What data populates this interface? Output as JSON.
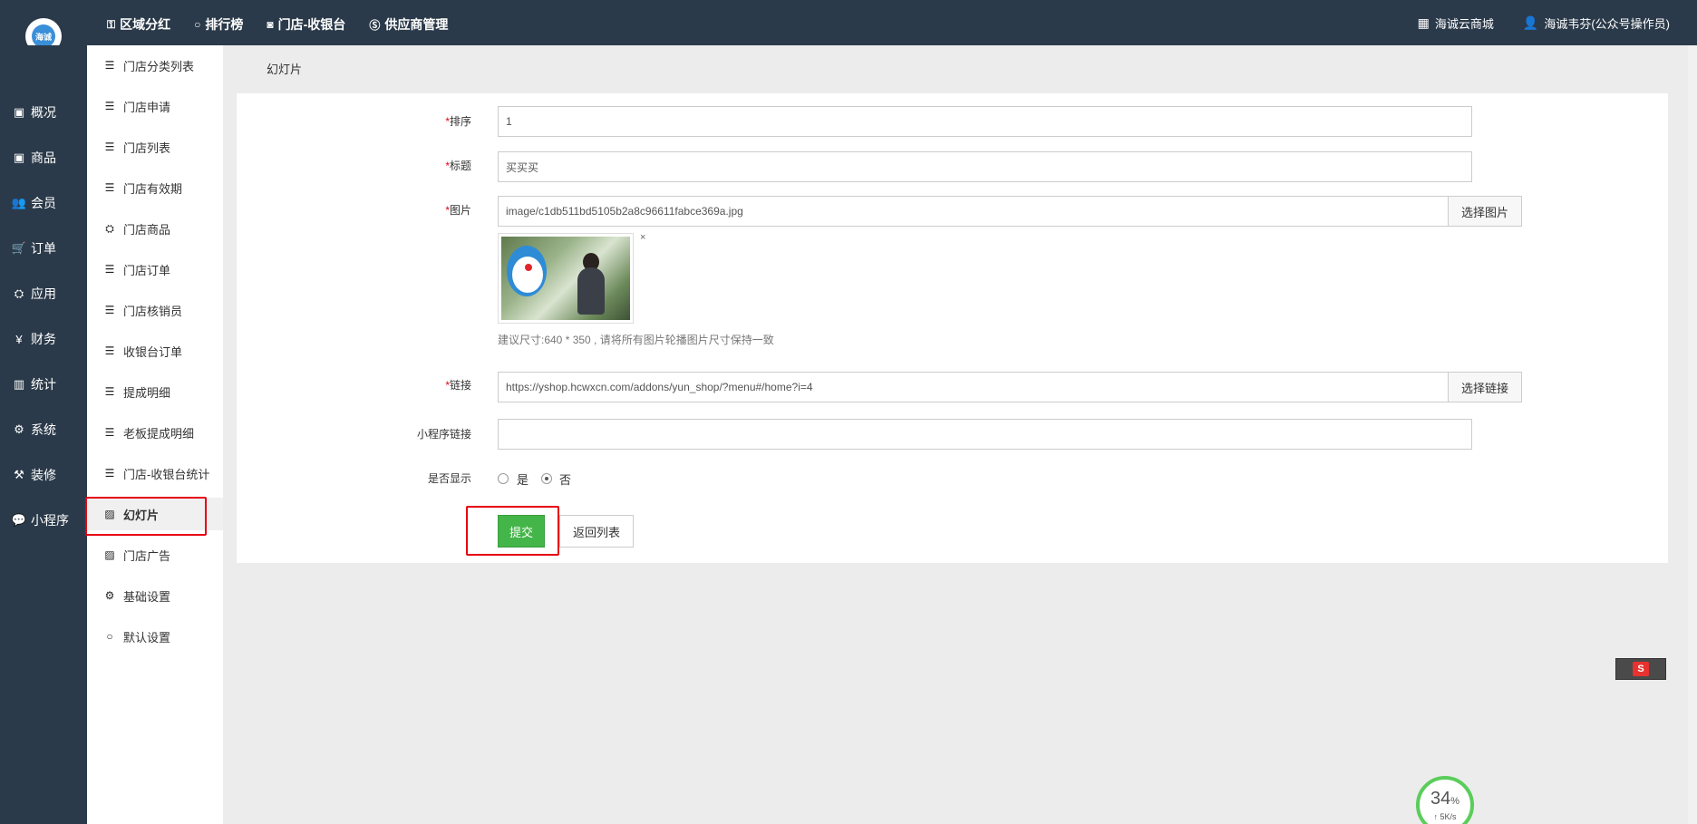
{
  "topbar": {
    "logo_text": "海诚",
    "nav": [
      {
        "icon": "key-icon",
        "glyph": "⚿",
        "label": "区域分红"
      },
      {
        "icon": "circle-icon",
        "glyph": "○",
        "label": "排行榜"
      },
      {
        "icon": "camera-icon",
        "glyph": "◙",
        "label": "门店-收银台"
      },
      {
        "icon": "skype-icon",
        "glyph": "Ⓢ",
        "label": "供应商管理"
      }
    ],
    "right": [
      {
        "icon": "grid-icon",
        "glyph": "▦",
        "label": "海诚云商城"
      },
      {
        "icon": "user-icon",
        "glyph": "👤",
        "label": "海诚韦芬(公众号操作员)"
      }
    ]
  },
  "sidebar": {
    "items": [
      {
        "icon": "overview-icon",
        "glyph": "▣",
        "label": "概况"
      },
      {
        "icon": "goods-icon",
        "glyph": "▣",
        "label": "商品"
      },
      {
        "icon": "members-icon",
        "glyph": "👥",
        "label": "会员"
      },
      {
        "icon": "cart-icon",
        "glyph": "🛒",
        "label": "订单"
      },
      {
        "icon": "apps-icon",
        "glyph": "⛭",
        "label": "应用"
      },
      {
        "icon": "yen-icon",
        "glyph": "¥",
        "label": "财务"
      },
      {
        "icon": "chart-icon",
        "glyph": "▥",
        "label": "统计"
      },
      {
        "icon": "settings-icon",
        "glyph": "⚙",
        "label": "系统"
      },
      {
        "icon": "hammer-icon",
        "glyph": "⚒",
        "label": "装修"
      },
      {
        "icon": "wechat-icon",
        "glyph": "💬",
        "label": "小程序"
      }
    ]
  },
  "submenu": {
    "items": [
      {
        "icon": "list-icon",
        "glyph": "☰",
        "label": "门店分类列表"
      },
      {
        "icon": "list-icon",
        "glyph": "☰",
        "label": "门店申请"
      },
      {
        "icon": "list-icon",
        "glyph": "☰",
        "label": "门店列表"
      },
      {
        "icon": "list-icon",
        "glyph": "☰",
        "label": "门店有效期"
      },
      {
        "icon": "cubes-icon",
        "glyph": "⛭",
        "label": "门店商品"
      },
      {
        "icon": "list-icon",
        "glyph": "☰",
        "label": "门店订单"
      },
      {
        "icon": "list-icon",
        "glyph": "☰",
        "label": "门店核销员"
      },
      {
        "icon": "list-icon",
        "glyph": "☰",
        "label": "收银台订单"
      },
      {
        "icon": "list-icon",
        "glyph": "☰",
        "label": "提成明细"
      },
      {
        "icon": "list-icon",
        "glyph": "☰",
        "label": "老板提成明细"
      },
      {
        "icon": "list-icon",
        "glyph": "☰",
        "label": "门店-收银台统计"
      },
      {
        "icon": "image-icon",
        "glyph": "▨",
        "label": "幻灯片"
      },
      {
        "icon": "image-icon",
        "glyph": "▨",
        "label": "门店广告"
      },
      {
        "icon": "gears-icon",
        "glyph": "⚙",
        "label": "基础设置"
      },
      {
        "icon": "circle-icon",
        "glyph": "○",
        "label": "默认设置"
      }
    ],
    "active_index": 11
  },
  "page": {
    "breadcrumb": "幻灯片"
  },
  "form": {
    "required_mark": "*",
    "sort_label": "排序",
    "sort_value": "1",
    "title_label": "标题",
    "title_value": "买买买",
    "image_label": "图片",
    "image_value": "image/c1db511bd5105b2a8c96611fabce369a.jpg",
    "image_button": "选择图片",
    "image_remove": "×",
    "image_hint": "建议尺寸:640 * 350 , 请将所有图片轮播图片尺寸保持一致",
    "link_label": "链接",
    "link_value": "https://yshop.hcwxcn.com/addons/yun_shop/?menu#/home?i=4",
    "link_button": "选择链接",
    "mini_link_label": "小程序链接",
    "mini_link_value": "",
    "show_label": "是否显示",
    "show_options": [
      "是",
      "否"
    ],
    "show_selected": "否",
    "submit_label": "提交",
    "back_label": "返回列表"
  },
  "overlay": {
    "ime_label": "S",
    "network_percent": "34",
    "network_percent_unit": "%",
    "network_speed": "↑ 5K/s"
  }
}
